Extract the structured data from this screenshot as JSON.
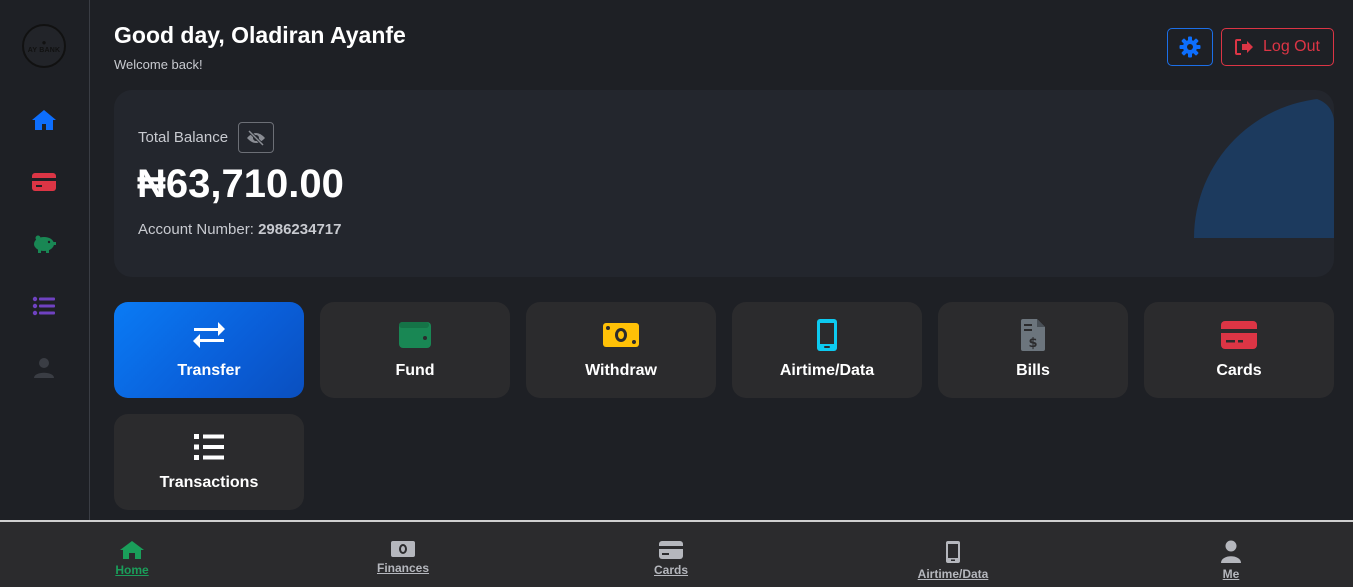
{
  "brand": {
    "logo_text": "AY BANK"
  },
  "sidebar": {
    "items": [
      {
        "icon": "home-icon",
        "color": "#0d6efd"
      },
      {
        "icon": "credit-card-icon",
        "color": "#dc3545"
      },
      {
        "icon": "piggy-bank-icon",
        "color": "#198754"
      },
      {
        "icon": "list-icon",
        "color": "#6f42c1"
      },
      {
        "icon": "user-icon",
        "color": "#3a3d44"
      }
    ]
  },
  "header": {
    "greeting": "Good day, Oladiran Ayanfe",
    "subtitle": "Welcome back!",
    "logout_label": "Log Out"
  },
  "balance": {
    "label": "Total Balance",
    "amount": "₦63,710.00",
    "account_label": "Account Number:",
    "account_number": "2986234717"
  },
  "actions": [
    {
      "label": "Transfer",
      "icon": "transfer-arrows-icon",
      "color": "#ffffff"
    },
    {
      "label": "Fund",
      "icon": "wallet-icon",
      "color": "#198754"
    },
    {
      "label": "Withdraw",
      "icon": "money-bill-icon",
      "color": "#ffc107"
    },
    {
      "label": "Airtime/Data",
      "icon": "mobile-phone-icon",
      "color": "#0dcaf0"
    },
    {
      "label": "Bills",
      "icon": "invoice-dollar-icon",
      "color": "#6c757d"
    },
    {
      "label": "Cards",
      "icon": "credit-card-icon",
      "color": "#dc3545"
    },
    {
      "label": "Transactions",
      "icon": "list-icon",
      "color": "#ffffff"
    }
  ],
  "bottom_nav": [
    {
      "label": "Home",
      "icon": "home-icon",
      "active": true
    },
    {
      "label": "Finances",
      "icon": "money-bill-icon",
      "active": false
    },
    {
      "label": "Cards",
      "icon": "credit-card-icon",
      "active": false
    },
    {
      "label": "Airtime/Data",
      "icon": "mobile-phone-icon",
      "active": false
    },
    {
      "label": "Me",
      "icon": "user-icon",
      "active": false
    }
  ],
  "colors": {
    "accent": "#0d6efd",
    "danger": "#dc3545",
    "success": "#198754",
    "background": "#1e2025",
    "card": "#2b2b2d"
  }
}
